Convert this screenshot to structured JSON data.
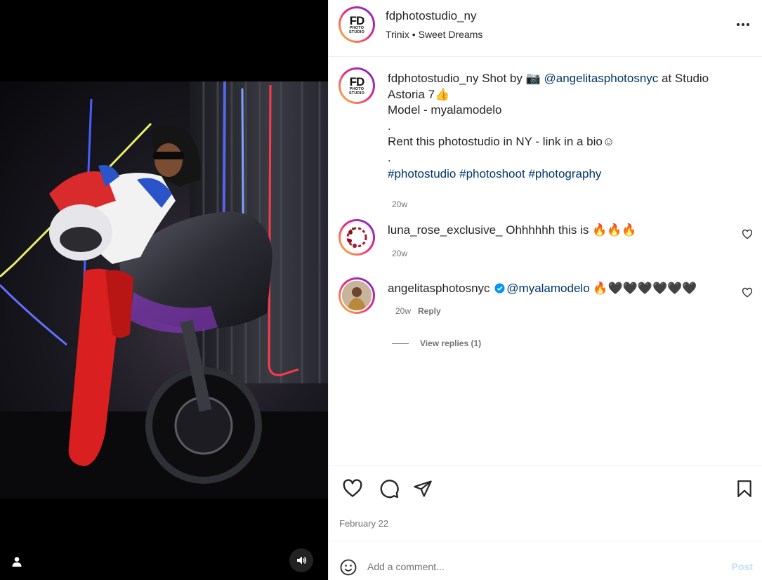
{
  "header": {
    "username": "fdphotostudio_ny",
    "audio_artist": "Trinix",
    "audio_separator": "•",
    "audio_track": "Sweet Dreams",
    "logo_line1": "FD",
    "logo_line2": "PHOTO",
    "logo_line3": "STUDIO"
  },
  "caption": {
    "username": "fdphotostudio_ny",
    "text1": " Shot by 📷  ",
    "mention": "@angelitasphotosnyc",
    "text2": " at Studio Astoria 7👍",
    "line2": "Model - myalamodelo",
    "line3": ".",
    "line4": "Rent this photostudio in NY - link in a bio☺",
    "line5": ".",
    "tag1": "#photostudio",
    "tag2": "#photoshoot",
    "tag3": "#photography",
    "time": "20w"
  },
  "comments": [
    {
      "username": "luna_rose_exclusive_",
      "text": " Ohhhhhh this is 🔥🔥🔥",
      "time": "20w"
    },
    {
      "username": "angelitasphotosnyc",
      "mention": "@myalamodelo",
      "text": " 🔥🖤🖤🖤🖤🖤🖤",
      "time": "20w",
      "reply_label": "Reply"
    }
  ],
  "view_replies": "View replies (1)",
  "post_date": "February 22",
  "add_comment": {
    "placeholder": "Add a comment...",
    "post_label": "Post"
  },
  "icons": {
    "more": "more-options-icon",
    "like": "heart-icon",
    "comment": "comment-icon",
    "share": "share-icon",
    "save": "bookmark-icon",
    "emoji": "emoji-icon",
    "audio": "speaker-icon",
    "user_tag": "person-icon",
    "verified": "verified-badge-icon"
  },
  "colors": {
    "link": "#00376b",
    "secondary_text": "#737373",
    "post_button_disabled": "#c0dffd",
    "verified_blue": "#0095f6"
  }
}
